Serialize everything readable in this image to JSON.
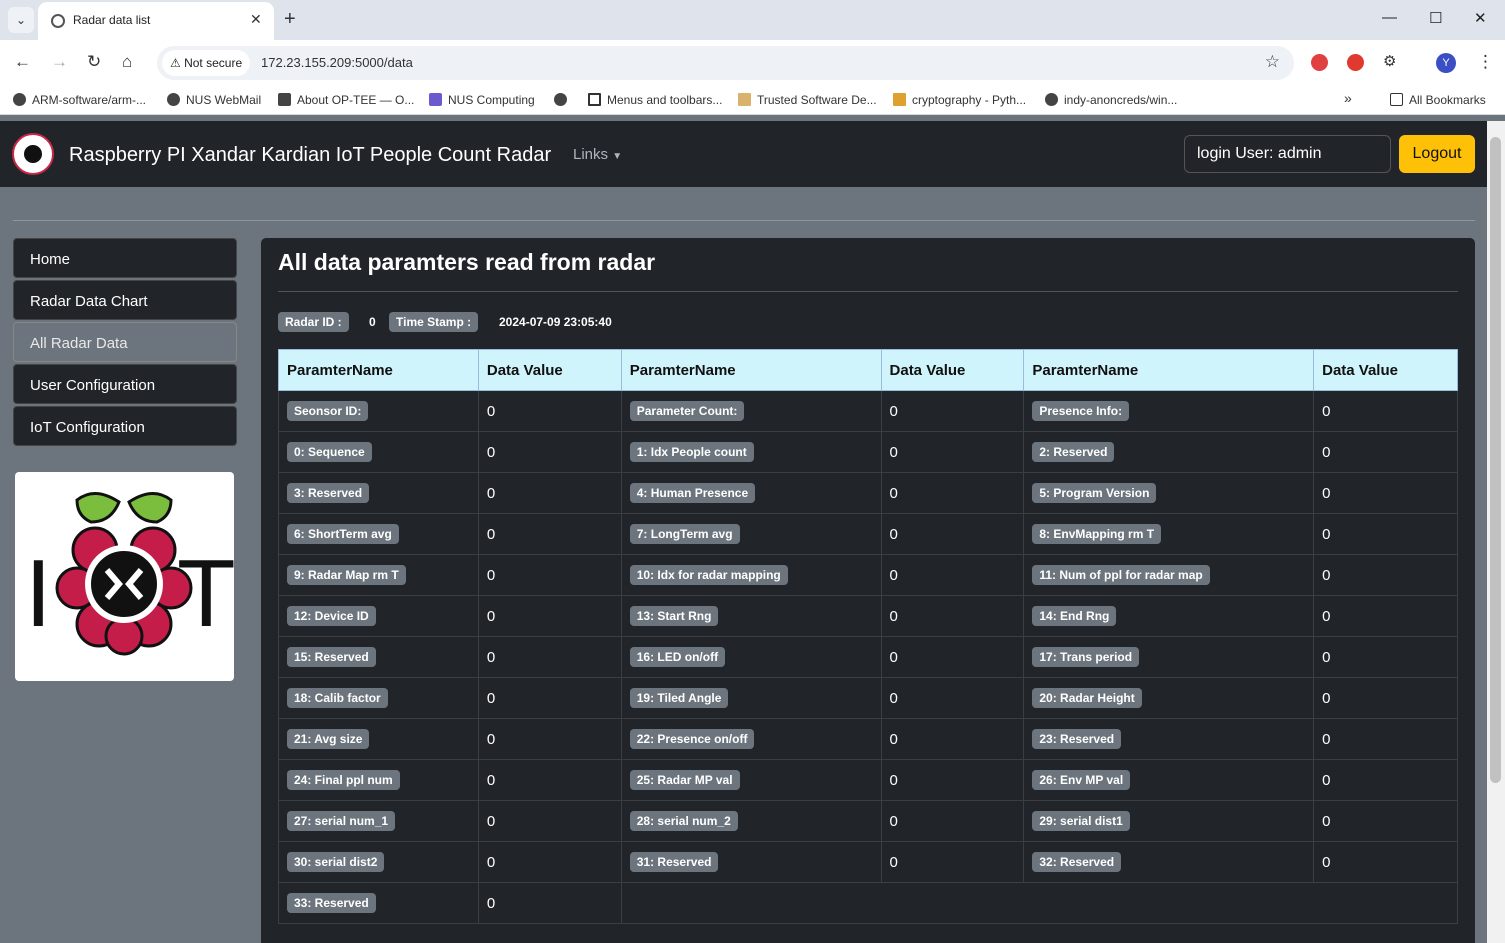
{
  "browser": {
    "tab_title": "Radar data list",
    "security_label": "Not secure",
    "url": "172.23.155.209:5000/data",
    "bookmarks": [
      "ARM-software/arm-...",
      "NUS WebMail",
      "About OP-TEE — O...",
      "NUS Computing",
      "",
      "Menus and toolbars...",
      "Trusted Software De...",
      "cryptography - Pyth...",
      "indy-anoncreds/win..."
    ],
    "all_bookmarks": "All Bookmarks",
    "profile_initial": "Y"
  },
  "navbar": {
    "brand": "Raspberry PI Xandar Kardian IoT People Count Radar",
    "links_label": "Links",
    "login_user": "login User: admin",
    "logout_label": "Logout"
  },
  "sidebar": {
    "items": [
      "Home",
      "Radar Data Chart",
      "All Radar Data",
      "User Configuration",
      "IoT Configuration"
    ],
    "active": "All Radar Data"
  },
  "main": {
    "title": "All data paramters read from radar",
    "radar_id_label": "Radar ID :",
    "radar_id_value": "0",
    "timestamp_label": "Time Stamp :",
    "timestamp_value": "2024-07-09 23:05:40",
    "headers": [
      "ParamterName",
      "Data Value",
      "ParamterName",
      "Data Value",
      "ParamterName",
      "Data Value"
    ],
    "rows": [
      [
        [
          "Seonsor ID:",
          "0"
        ],
        [
          "Parameter Count:",
          "0"
        ],
        [
          "Presence Info:",
          "0"
        ]
      ],
      [
        [
          "0: Sequence",
          "0"
        ],
        [
          "1: Idx People count",
          "0"
        ],
        [
          "2: Reserved",
          "0"
        ]
      ],
      [
        [
          "3: Reserved",
          "0"
        ],
        [
          "4: Human Presence",
          "0"
        ],
        [
          "5: Program Version",
          "0"
        ]
      ],
      [
        [
          "6: ShortTerm avg",
          "0"
        ],
        [
          "7: LongTerm avg",
          "0"
        ],
        [
          "8: EnvMapping rm T",
          "0"
        ]
      ],
      [
        [
          "9: Radar Map rm T",
          "0"
        ],
        [
          "10: Idx for radar mapping",
          "0"
        ],
        [
          "11: Num of ppl for radar map",
          "0"
        ]
      ],
      [
        [
          "12: Device ID",
          "0"
        ],
        [
          "13: Start Rng",
          "0"
        ],
        [
          "14: End Rng",
          "0"
        ]
      ],
      [
        [
          "15: Reserved",
          "0"
        ],
        [
          "16: LED on/off",
          "0"
        ],
        [
          "17: Trans period",
          "0"
        ]
      ],
      [
        [
          "18: Calib factor",
          "0"
        ],
        [
          "19: Tiled Angle",
          "0"
        ],
        [
          "20: Radar Height",
          "0"
        ]
      ],
      [
        [
          "21: Avg size",
          "0"
        ],
        [
          "22: Presence on/off",
          "0"
        ],
        [
          "23: Reserved",
          "0"
        ]
      ],
      [
        [
          "24: Final ppl num",
          "0"
        ],
        [
          "25: Radar MP val",
          "0"
        ],
        [
          "26: Env MP val",
          "0"
        ]
      ],
      [
        [
          "27: serial num_1",
          "0"
        ],
        [
          "28: serial num_2",
          "0"
        ],
        [
          "29: serial dist1",
          "0"
        ]
      ],
      [
        [
          "30: serial dist2",
          "0"
        ],
        [
          "31: Reserved",
          "0"
        ],
        [
          "32: Reserved",
          "0"
        ]
      ],
      [
        [
          "33: Reserved",
          "0"
        ]
      ]
    ]
  },
  "logo": {
    "letters_left": "I",
    "letters_right": "T"
  }
}
